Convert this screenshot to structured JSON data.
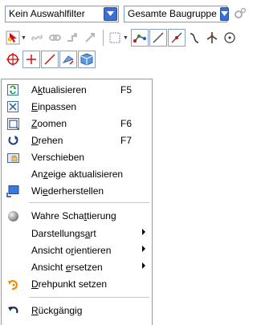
{
  "toolbar": {
    "filter_select": {
      "value": "Kein Auswahlfilter"
    },
    "assembly_select": {
      "value": "Gesamte Baugruppe"
    }
  },
  "menu": {
    "items": [
      {
        "pre": "A",
        "u": "k",
        "post": "tualisieren",
        "shortcut": "F5",
        "icon": "refresh-icon"
      },
      {
        "pre": "",
        "u": "E",
        "post": "inpassen",
        "shortcut": "",
        "icon": "fit-icon"
      },
      {
        "pre": "",
        "u": "Z",
        "post": "oomen",
        "shortcut": "F6",
        "icon": "zoom-icon"
      },
      {
        "pre": "",
        "u": "D",
        "post": "rehen",
        "shortcut": "F7",
        "icon": "rotate-icon"
      },
      {
        "pre": "",
        "u": "",
        "post": "Verschieben",
        "shortcut": "",
        "icon": "pan-icon"
      },
      {
        "pre": "An",
        "u": "z",
        "post": "eige aktualisieren",
        "shortcut": "",
        "icon": ""
      },
      {
        "pre": "Wi",
        "u": "e",
        "post": "derherstellen",
        "shortcut": "",
        "icon": "restore-icon"
      },
      {
        "pre": "Wahre Scha",
        "u": "t",
        "post": "tierung",
        "shortcut": "",
        "icon": "shading-icon"
      },
      {
        "pre": "Darstellungs",
        "u": "a",
        "post": "rt",
        "shortcut": "",
        "icon": ""
      },
      {
        "pre": "Ansicht o",
        "u": "r",
        "post": "ientieren",
        "shortcut": "",
        "icon": ""
      },
      {
        "pre": "Ansicht ",
        "u": "e",
        "post": "rsetzen",
        "shortcut": "",
        "icon": ""
      },
      {
        "pre": "",
        "u": "D",
        "post": "rehpunkt setzen",
        "shortcut": "",
        "icon": "pivot-icon"
      },
      {
        "pre": "",
        "u": "R",
        "post": "ückgängig",
        "shortcut": "",
        "icon": "undo-icon"
      }
    ]
  },
  "colors": {
    "combo_arrow": "#3a6fd8",
    "menu_border": "#9a9a9a",
    "pivot_orange": "#f08a00"
  }
}
